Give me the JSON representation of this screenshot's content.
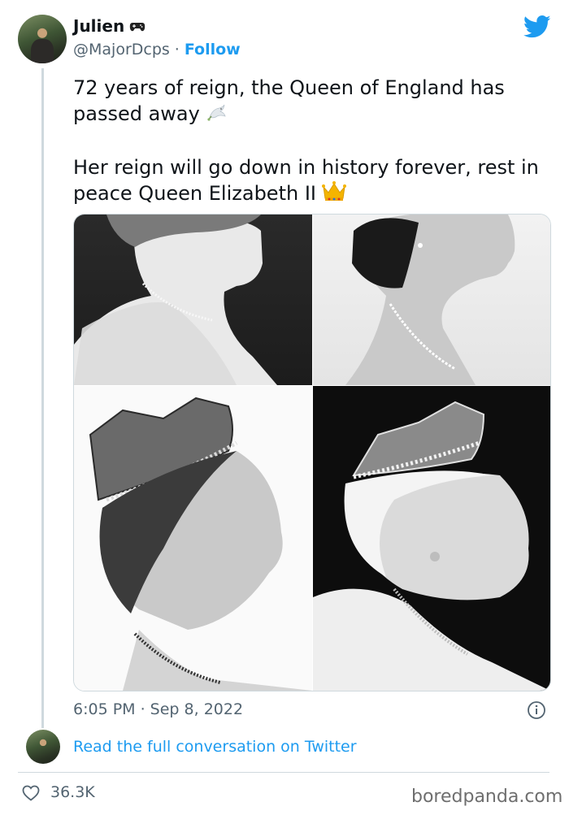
{
  "user": {
    "name": "Julien",
    "handle": "@MajorDcps",
    "separator": "·",
    "follow_label": "Follow"
  },
  "tweet": {
    "line1": "72 years of reign, the Queen of England has passed away",
    "line2": "Her reign will go down in history forever, rest in peace Queen Elizabeth II",
    "emoji1": "dove-emoji",
    "emoji2": "crown-emoji",
    "timestamp": "6:05 PM · Sep 8, 2022"
  },
  "footer": {
    "read_link": "Read the full conversation on Twitter",
    "likes": "36.3K",
    "watermark": "boredpanda.com"
  },
  "colors": {
    "twitter_blue": "#1d9bf0",
    "secondary_text": "#536471",
    "border": "#cfd9de"
  },
  "icons": [
    "gamepad-icon",
    "twitter-bird-icon",
    "info-icon",
    "heart-icon"
  ]
}
